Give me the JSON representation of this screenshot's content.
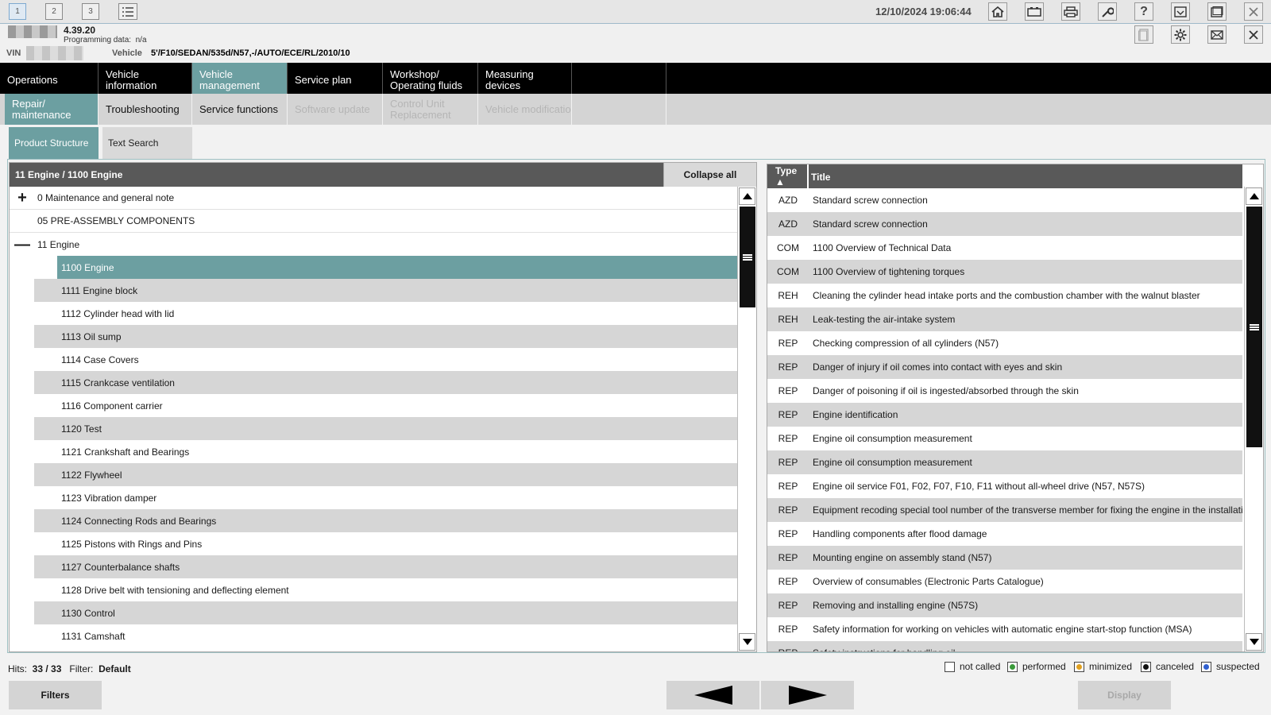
{
  "workspaces": [
    "1",
    "2",
    "3"
  ],
  "datetime": "12/10/2024 19:06:44",
  "icons": [
    "home-icon",
    "battery-icon",
    "print-icon",
    "wrench-icon",
    "help-icon",
    "minimize-icon",
    "window-icon",
    "close-icon",
    "document-icon",
    "gear-icon",
    "mail-icon",
    "close-icon"
  ],
  "info": {
    "version": "4.39.20",
    "programming_label": "Programming data:",
    "programming_value": "n/a",
    "vin_label": "VIN",
    "vehicle_label": "Vehicle",
    "vehicle_value": "5'/F10/SEDAN/535d/N57,-/AUTO/ECE/RL/2010/10"
  },
  "nav_main": [
    "Operations",
    "Vehicle information",
    "Vehicle management",
    "Service plan",
    "Workshop/ Operating fluids",
    "Measuring devices"
  ],
  "nav_sub": [
    "Repair/ maintenance",
    "Troubleshooting",
    "Service functions",
    "Software update",
    "Control Unit Replacement",
    "Vehicle modification"
  ],
  "tabs": [
    "Product Structure",
    "Text Search"
  ],
  "tree": {
    "header": "11 Engine / 1100 Engine",
    "collapse_label": "Collapse all",
    "expand_symbol": "+",
    "collapse_symbol": "—",
    "items": [
      "0 Maintenance and general note",
      "05 PRE-ASSEMBLY COMPONENTS",
      "11 Engine",
      "1100 Engine",
      "1111 Engine block",
      "1112 Cylinder head with lid",
      "1113 Oil sump",
      "1114 Case Covers",
      "1115 Crankcase ventilation",
      "1116 Component carrier",
      "1120 Test",
      "1121 Crankshaft and Bearings",
      "1122 Flywheel",
      "1123 Vibration damper",
      "1124 Connecting Rods and Bearings",
      "1125 Pistons with Rings and Pins",
      "1127 Counterbalance shafts",
      "1128 Drive belt with tensioning and deflecting element",
      "1130 Control",
      "1131 Camshaft"
    ]
  },
  "results": {
    "col_type": "Type ▲",
    "col_title": "Title",
    "rows": [
      [
        "AZD",
        "Standard screw connection"
      ],
      [
        "AZD",
        "Standard screw connection"
      ],
      [
        "COM",
        "1100 Overview of Technical Data"
      ],
      [
        "COM",
        "1100 Overview of tightening torques"
      ],
      [
        "REH",
        "Cleaning the cylinder head intake ports and the combustion chamber with the walnut blaster"
      ],
      [
        "REH",
        "Leak-testing the air-intake system"
      ],
      [
        "REP",
        "Checking compression of all cylinders (N57)"
      ],
      [
        "REP",
        "Danger of injury if oil comes into contact with eyes and skin"
      ],
      [
        "REP",
        "Danger of poisoning if oil is ingested/absorbed through the skin"
      ],
      [
        "REP",
        "Engine identification"
      ],
      [
        "REP",
        "Engine oil consumption measurement"
      ],
      [
        "REP",
        "Engine oil consumption measurement"
      ],
      [
        "REP",
        "Engine oil service F01, F02, F07, F10, F11 without all-wheel drive (N57, N57S)"
      ],
      [
        "REP",
        "Equipment recoding special tool number of the transverse member for fixing the engine in the installation"
      ],
      [
        "REP",
        "Handling components after flood damage"
      ],
      [
        "REP",
        "Mounting engine on assembly stand (N57)"
      ],
      [
        "REP",
        "Overview of consumables (Electronic Parts Catalogue)"
      ],
      [
        "REP",
        "Removing and installing engine (N57S)"
      ],
      [
        "REP",
        "Safety information for working on vehicles with automatic engine start-stop function (MSA)"
      ],
      [
        "REP",
        "Safety instructions for handling oil"
      ]
    ]
  },
  "status": {
    "hits_label": "Hits:",
    "hits_value": "33 / 33",
    "filter_label": "Filter:",
    "filter_value": "Default",
    "legend": [
      {
        "label": "not called",
        "color": ""
      },
      {
        "label": "performed",
        "color": "#3a9a3a"
      },
      {
        "label": "minimized",
        "color": "#e0a020"
      },
      {
        "label": "canceled",
        "color": "#111111"
      },
      {
        "label": "suspected",
        "color": "#3060d0"
      }
    ]
  },
  "buttons": {
    "filters": "Filters",
    "display": "Display"
  },
  "colors": {
    "accent": "#6c9fa1",
    "header_dark": "#595959"
  }
}
